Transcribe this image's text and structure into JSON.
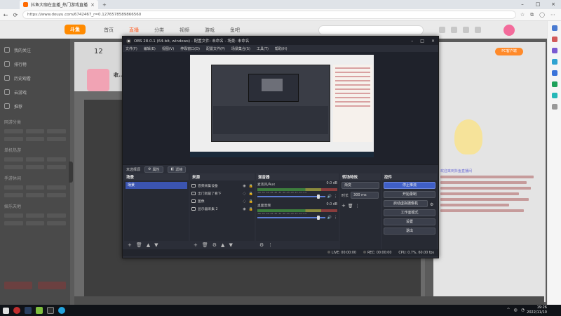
{
  "browser": {
    "tab_title": "抖鱼大咖在直播_热门游戏直播_",
    "url": "https://www.douyu.com/6742467_r=0.1276578589866560",
    "tab_close": "×",
    "new_tab": "+",
    "win_min": "–",
    "win_max": "□",
    "win_close": "×",
    "back": "←",
    "refresh": "⟳"
  },
  "site": {
    "logo": "斗鱼",
    "nav": [
      "首页",
      "直播",
      "分类",
      "视频",
      "游戏",
      "鱼吧"
    ],
    "active_nav_index": 1,
    "sidebar": [
      "我的关注",
      "排行榜",
      "历史观看",
      "云游戏",
      "推荐"
    ],
    "sidebar_sections": [
      "网游分类",
      "单机热游",
      "手游休闲",
      "娱乐天地"
    ],
    "count": "12",
    "room_name": "收...",
    "pc_button": "PC客户端",
    "welcome": "欢迎来到抖鱼直播间"
  },
  "obs": {
    "title": "OBS 28.0.1 (64-bit, windows) - 配置文件: 未命名 - 场景: 未命名",
    "win_min": "–",
    "win_max": "□",
    "win_close": "×",
    "menu": [
      "文件(F)",
      "编辑(E)",
      "视图(V)",
      "停靠窗口(D)",
      "配置文件(P)",
      "场景集合(S)",
      "工具(T)",
      "帮助(H)"
    ],
    "source_bar": {
      "label": "未选择源",
      "props": "属性",
      "filters": "滤镜"
    },
    "scenes": {
      "title": "场景",
      "items": [
        "场景"
      ]
    },
    "sources": {
      "title": "来源",
      "items": [
        {
          "name": "音频采集设备",
          "icon": "audio-capture-icon"
        },
        {
          "name": "出门就是了看下",
          "icon": "text-icon"
        },
        {
          "name": "图像",
          "icon": "image-icon"
        },
        {
          "name": "显示器采集 2",
          "icon": "display-capture-icon"
        }
      ]
    },
    "mixer": {
      "title": "混音器",
      "channels": [
        {
          "name": "麦克风/Aux",
          "db": "0.0 dB"
        },
        {
          "name": "桌面音频",
          "db": "0.0 dB"
        }
      ],
      "ticks": "-60 -55 -50 -45 -40 -35 -30 -25 -20 -15 -10 -5 0"
    },
    "transitions": {
      "title": "转场特效",
      "selected": "渐变",
      "duration_label": "时长",
      "duration": "300 ms"
    },
    "controls": {
      "title": "控件",
      "buttons": [
        "停止推流",
        "开始录制",
        "启动虚拟摄像机",
        "工作室模式",
        "设置",
        "退出"
      ]
    },
    "status": {
      "live": "LIVE: 00:00:00",
      "rec": "REC: 00:00:00",
      "cpu": "CPU: 0.7%, 60.00 fps"
    }
  },
  "taskbar": {
    "time": "19:26",
    "date": "2022/11/10"
  },
  "colors": {
    "accent_orange": "#ff5d23",
    "obs_blue": "#3f5fc7"
  }
}
